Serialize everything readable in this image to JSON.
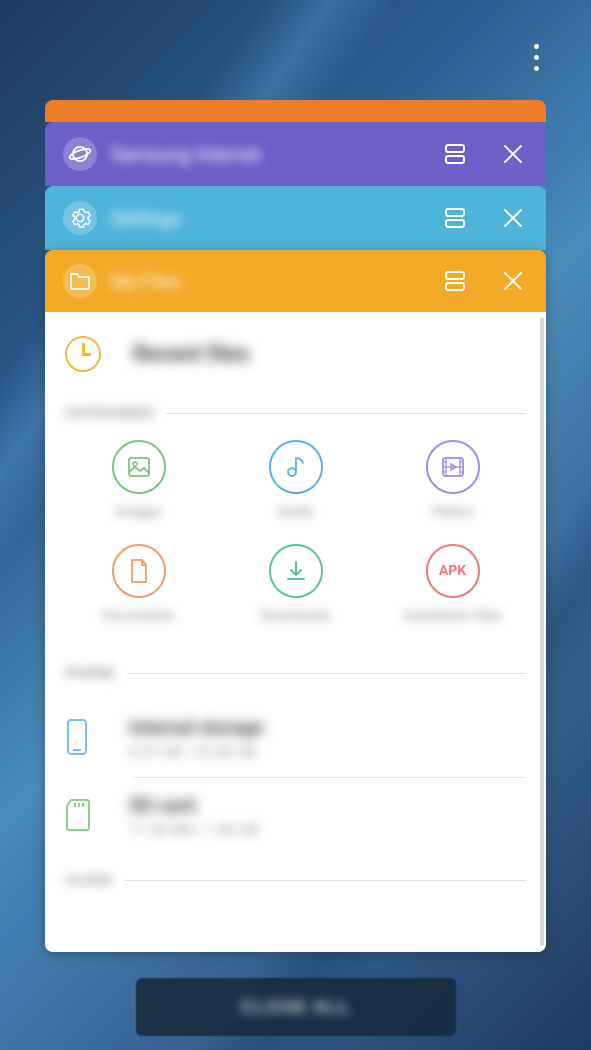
{
  "more_menu": "more-options",
  "stacked_cards": [
    {
      "id": "orange",
      "title": ""
    },
    {
      "id": "purple",
      "title": "Samsung Internet",
      "icon": "planet-icon"
    },
    {
      "id": "blue",
      "title": "Settings",
      "icon": "gear-icon"
    }
  ],
  "top_card": {
    "title": "My Files",
    "icon": "folder-icon",
    "recent_label": "Recent files",
    "sections": {
      "categories_label": "CATEGORIES",
      "phone_label": "PHONE",
      "cloud_label": "CLOUD"
    },
    "categories": [
      {
        "name": "images",
        "label": "Images",
        "color": "#7bc47f"
      },
      {
        "name": "audio",
        "label": "Audio",
        "color": "#5bb0e8"
      },
      {
        "name": "videos",
        "label": "Videos",
        "color": "#a68be5"
      },
      {
        "name": "documents",
        "label": "Documents",
        "color": "#f59a6f"
      },
      {
        "name": "downloads",
        "label": "Downloads",
        "color": "#5cc29f"
      },
      {
        "name": "apk",
        "label": "Installation files",
        "apk_text": "APK",
        "color": "#f07878"
      }
    ],
    "storage": [
      {
        "name": "internal",
        "title": "Internal storage",
        "subtitle": "8.07 GB / 32.00 GB",
        "icon_color": "#7bbde8"
      },
      {
        "name": "sd",
        "title": "SD card",
        "subtitle": "11.30 MB / 1.86 GB",
        "icon_color": "#8bcf8f"
      }
    ]
  },
  "close_all": "CLOSE ALL"
}
